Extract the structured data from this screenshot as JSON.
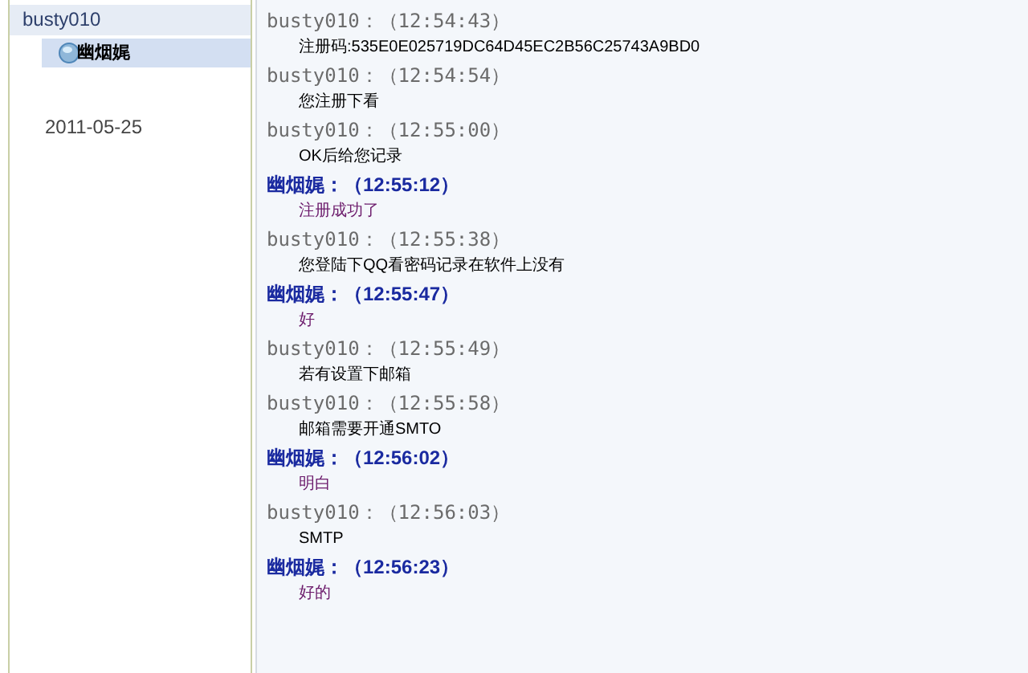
{
  "sidebar": {
    "contact": "busty010",
    "items": [
      {
        "label": "幽烟娓",
        "selected": true
      }
    ],
    "date": "2011-05-25"
  },
  "messages": [
    {
      "kind": "other",
      "header": "busty010：（12:54:43）",
      "text": "注册码:535E0E025719DC64D45EC2B56C25743A9BD0"
    },
    {
      "kind": "other",
      "header": "busty010：（12:54:54）",
      "text": "您注册下看"
    },
    {
      "kind": "other",
      "header": "busty010：（12:55:00）",
      "text": "OK后给您记录"
    },
    {
      "kind": "self",
      "header": "幽烟娓：（12:55:12）",
      "text": "注册成功了"
    },
    {
      "kind": "other",
      "header": "busty010：（12:55:38）",
      "text": "您登陆下QQ看密码记录在软件上没有"
    },
    {
      "kind": "self",
      "header": "幽烟娓：（12:55:47）",
      "text": "好"
    },
    {
      "kind": "other",
      "header": "busty010：（12:55:49）",
      "text": "若有设置下邮箱"
    },
    {
      "kind": "other",
      "header": "busty010：（12:55:58）",
      "text": "邮箱需要开通SMTO"
    },
    {
      "kind": "self",
      "header": "幽烟娓：（12:56:02）",
      "text": "明白"
    },
    {
      "kind": "other",
      "header": "busty010：（12:56:03）",
      "text": "SMTP"
    },
    {
      "kind": "self",
      "header": "幽烟娓：（12:56:23）",
      "text": "好的"
    }
  ]
}
